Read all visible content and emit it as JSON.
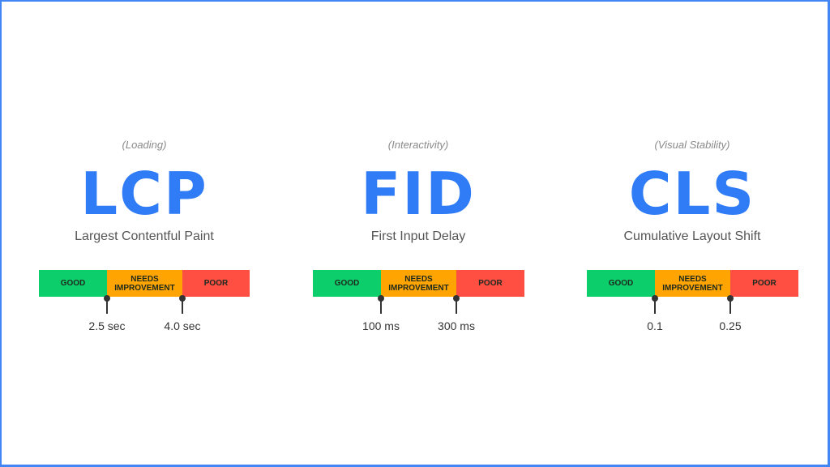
{
  "colors": {
    "accent": "#2f7cf6",
    "frame": "#4285f4",
    "good": "#0cce6b",
    "needs_improvement": "#ffa400",
    "poor": "#ff4e42"
  },
  "segment_labels": {
    "good": "GOOD",
    "needs_improvement_line1": "NEEDS",
    "needs_improvement_line2": "IMPROVEMENT",
    "poor": "POOR"
  },
  "metrics": [
    {
      "category": "(Loading)",
      "abbr": "LCP",
      "name": "Largest Contentful Paint",
      "thresholds": [
        "2.5 sec",
        "4.0 sec"
      ]
    },
    {
      "category": "(Interactivity)",
      "abbr": "FID",
      "name": "First Input Delay",
      "thresholds": [
        "100 ms",
        "300 ms"
      ]
    },
    {
      "category": "(Visual Stability)",
      "abbr": "CLS",
      "name": "Cumulative Layout Shift",
      "thresholds": [
        "0.1",
        "0.25"
      ]
    }
  ]
}
